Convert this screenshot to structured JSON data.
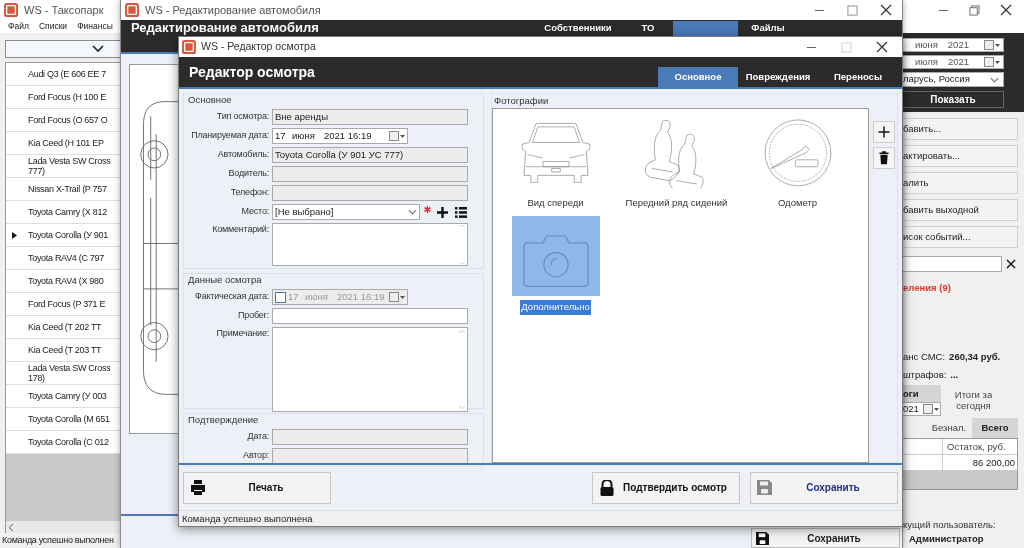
{
  "main_window": {
    "title": "WS - Таксопарк",
    "menu": [
      "Файл",
      "Списки",
      "Финансы"
    ],
    "vehicles": [
      {
        "name": "Audi Q3 (E 606 EE 7",
        "selected": false
      },
      {
        "name": "Ford Focus (H 100 E",
        "selected": false
      },
      {
        "name": "Ford Focus (O 657 O",
        "selected": false
      },
      {
        "name": "Kia Ceed (H 101 EP",
        "selected": false
      },
      {
        "name": "Lada Vesta SW Cross\n777)",
        "selected": false
      },
      {
        "name": "Nissan X-Trail (P 757",
        "selected": false
      },
      {
        "name": "Toyota Camry (X 812",
        "selected": false
      },
      {
        "name": "Toyota Corolla (У 901",
        "selected": true
      },
      {
        "name": "Toyota RAV4 (C 797",
        "selected": false
      },
      {
        "name": "Toyota RAV4 (X 980",
        "selected": false
      },
      {
        "name": "Ford Focus (P 371 E",
        "selected": false
      },
      {
        "name": "Kia Ceed (T 202 TT",
        "selected": false
      },
      {
        "name": "Kia Ceed (T 203 TT",
        "selected": false
      },
      {
        "name": "Lada Vesta SW Cross\n178)",
        "selected": false
      },
      {
        "name": "Toyota Camry (У 003",
        "selected": false
      },
      {
        "name": "Toyota Corolla (M 651",
        "selected": false
      },
      {
        "name": "Toyota Corolla (C 012",
        "selected": false
      }
    ],
    "status": "Команда успешно выполнен",
    "right_panel": {
      "date_from": {
        "month": "июня",
        "year": "2021"
      },
      "date_to": {
        "month": "июля",
        "year": "2021"
      },
      "region": "ларусь, Россия",
      "show_button": "Показать",
      "actions": [
        "бавить...",
        "актировать...",
        "алить",
        "бавить выходной",
        "исок событий..."
      ],
      "notice": "еления (9)",
      "sms_label": "анс СМС:",
      "sms_value": "260,34 руб.",
      "fines_label": "штрафов:",
      "fines_value": "...",
      "totals_header": "оги",
      "totals_date": "021",
      "today_totals": "Итоги за сегодня",
      "tabs": [
        {
          "label": "Безнал.",
          "selected": false
        },
        {
          "label": "Всего",
          "selected": true
        }
      ],
      "table": {
        "columns": [
          "Остаток, руб."
        ],
        "rows": [
          [
            "86 200,00"
          ]
        ]
      },
      "user_label": "кущий пользователь:",
      "user": "Администратор"
    }
  },
  "car_window": {
    "title": "WS - Редактирование автомобиля",
    "header": "Редактирование автомобиля",
    "tabs": [
      {
        "label": "Собственники",
        "selected": false
      },
      {
        "label": "ТО",
        "selected": false
      },
      {
        "selected": true
      },
      {
        "label": "Файлы",
        "selected": false
      }
    ],
    "save_button": "Сохранить"
  },
  "dialog": {
    "title": "WS - Редактор осмотра",
    "header": "Редактор осмотра",
    "tabs": [
      {
        "label": "Основное",
        "selected": true
      },
      {
        "label": "Повреждения",
        "selected": false
      },
      {
        "label": "Переносы",
        "selected": false
      }
    ],
    "sections": [
      {
        "title": "Основное",
        "fields": [
          {
            "label": "Тип осмотра:",
            "kind": "text",
            "value": "Вне аренды",
            "disabled": true
          },
          {
            "label": "Планируемая дата:",
            "kind": "date",
            "day": "17",
            "month": "июня",
            "time": "2021 16:19",
            "disabled": false
          },
          {
            "label": "Автомобиль:",
            "kind": "text",
            "value": "Toyota Corolla (У 901 УС 777)",
            "disabled": true
          },
          {
            "label": "Водитель:",
            "kind": "text",
            "disabled": true
          },
          {
            "label": "Телефон:",
            "kind": "text",
            "disabled": true
          },
          {
            "label": "Место:",
            "kind": "select",
            "value": "[Не выбрано]",
            "required": true,
            "disabled": false
          },
          {
            "label": "Комментарий:",
            "kind": "memo",
            "disabled": false
          }
        ]
      },
      {
        "title": "Данные осмотра",
        "fields": [
          {
            "label": "Фактическая дата:",
            "kind": "date",
            "checked": false,
            "day": "17",
            "month": "июня",
            "time": "2021 16:19",
            "disabled": true
          },
          {
            "label": "Пробег:",
            "kind": "text",
            "disabled": false
          },
          {
            "label": "Примечание:",
            "kind": "memo",
            "disabled": false
          }
        ]
      },
      {
        "title": "Подтверждение",
        "fields": [
          {
            "label": "Дата:",
            "kind": "text",
            "disabled": true
          },
          {
            "label": "Автор:",
            "kind": "text",
            "disabled": true
          }
        ]
      }
    ],
    "photos": {
      "title": "Фотографии",
      "items": [
        {
          "label": "Вид спереди",
          "kind": "front",
          "selected": false
        },
        {
          "label": "Передний ряд сидений",
          "kind": "seats",
          "selected": false
        },
        {
          "label": "Одометр",
          "kind": "odometer",
          "selected": false
        },
        {
          "label": "Дополнительно",
          "kind": "camera",
          "selected": true
        }
      ]
    },
    "buttons": [
      {
        "label": "Печать",
        "kind": "print"
      },
      {
        "label": "Подтвердить осмотр",
        "kind": "confirm"
      },
      {
        "label": "Сохранить",
        "kind": "save"
      }
    ],
    "status": "Команда успешно выполнена"
  }
}
